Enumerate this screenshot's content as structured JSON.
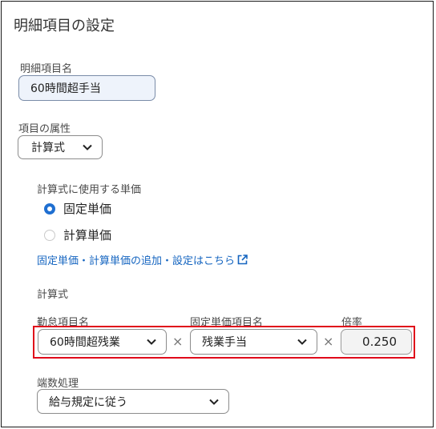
{
  "title": "明細項目の設定",
  "item_name": {
    "label": "明細項目名",
    "value": "60時間超手当"
  },
  "attribute": {
    "label": "項目の属性",
    "value": "計算式"
  },
  "unit_price": {
    "label": "計算式に使用する単価",
    "options": [
      {
        "label": "固定単価",
        "selected": true
      },
      {
        "label": "計算単価",
        "selected": false
      }
    ],
    "link": "固定単価・計算単価の追加・設定はこちら"
  },
  "formula": {
    "label": "計算式",
    "attendance_label": "勤怠項目名",
    "attendance_value": "60時間超残業",
    "fixed_price_label": "固定単価項目名",
    "fixed_price_value": "残業手当",
    "rate_label": "倍率",
    "rate_value": "0.250",
    "operator_1": "×",
    "operator_2": "×"
  },
  "rounding": {
    "label": "端数処理",
    "value": "給与規定に従う"
  },
  "colors": {
    "accent": "#1f6fd1",
    "link": "#1565c0",
    "highlight": "#e00a1a"
  }
}
